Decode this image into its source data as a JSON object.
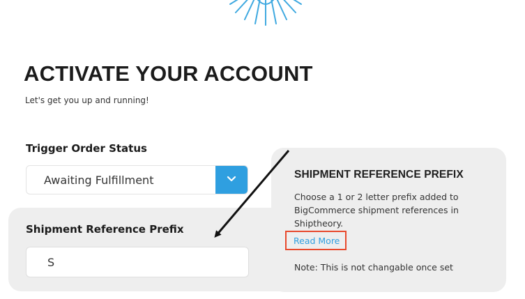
{
  "header": {
    "title": "ACTIVATE YOUR ACCOUNT",
    "subtitle": "Let's get you up and running!"
  },
  "form": {
    "trigger_label": "Trigger Order Status",
    "trigger_value": "Awaiting Fulfillment",
    "prefix_label": "Shipment Reference Prefix",
    "prefix_value": "S"
  },
  "help": {
    "title": "SHIPMENT REFERENCE PREFIX",
    "body": "Choose a 1 or 2 letter prefix added to BigCommerce shipment references in Shiptheory.",
    "read_more": "Read More",
    "note": "Note: This is not changable once set"
  },
  "colors": {
    "accent": "#2f9fe0",
    "highlight": "#e8492c",
    "panel": "#eeeeee"
  }
}
